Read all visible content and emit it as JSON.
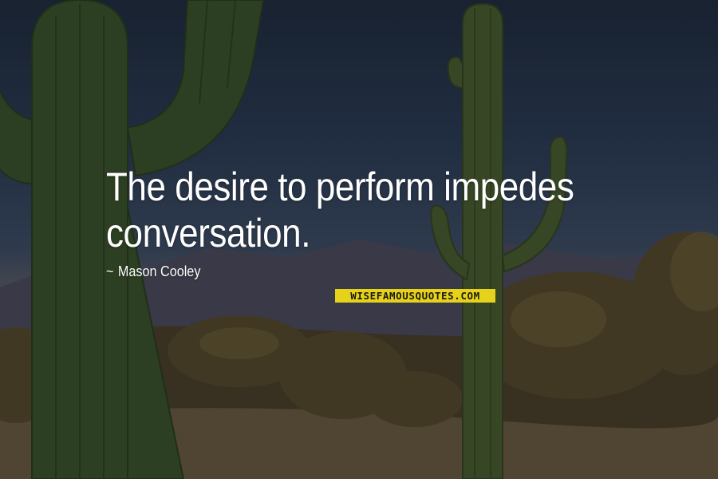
{
  "quote": {
    "lines": [
      "The desire to perform impedes",
      "conversation."
    ]
  },
  "author": {
    "dash": "~",
    "name": "Mason Cooley"
  },
  "watermark": {
    "text": "WISEFAMOUSQUOTES.COM"
  },
  "colors": {
    "sky": "#2a3a52",
    "cactus": "#3f5a2c",
    "brush": "#5a4a2a",
    "watermark_bg": "#e6d21a",
    "text": "#ffffff"
  }
}
